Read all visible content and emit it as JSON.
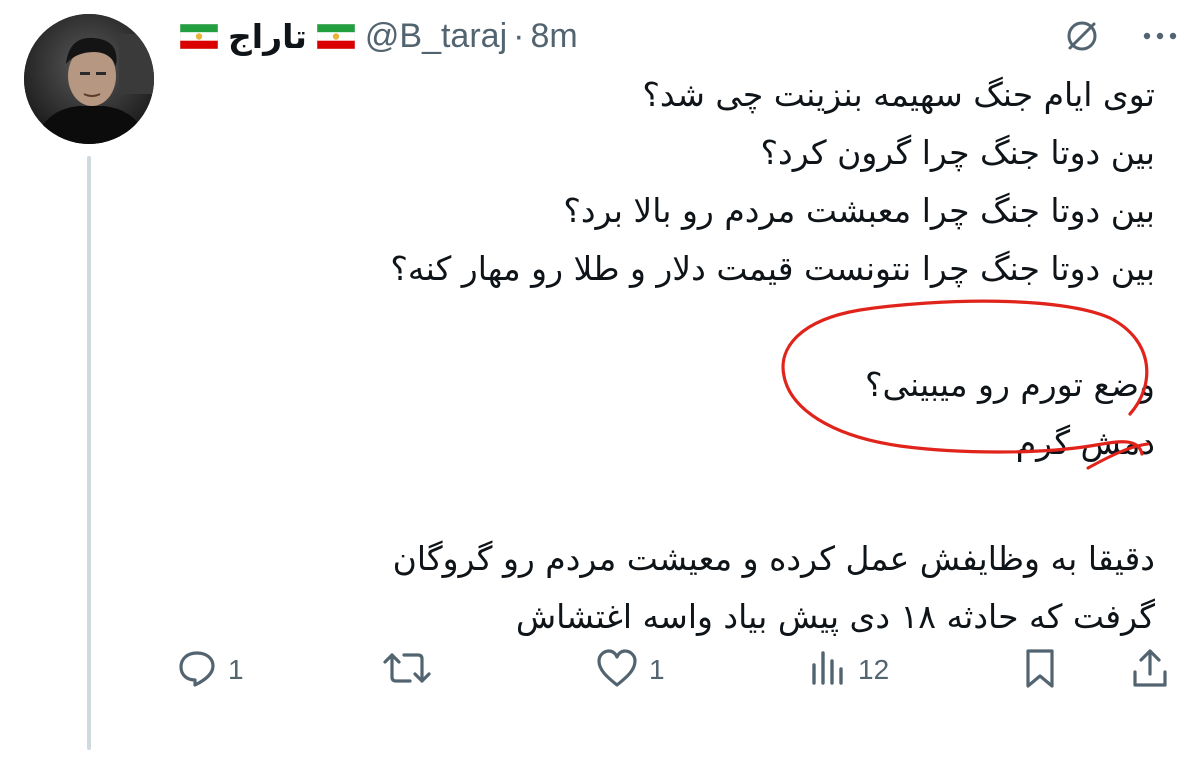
{
  "author": {
    "display_name": "تاراج",
    "handle": "@B_taraj",
    "separator": "·",
    "time": "8m"
  },
  "icons": {
    "flag": "iran-flag-icon",
    "grok": "grok-icon",
    "more": "more-icon",
    "reply": "reply-icon",
    "retweet": "retweet-icon",
    "like": "like-icon",
    "views": "views-icon",
    "bookmark": "bookmark-icon",
    "share": "share-icon"
  },
  "tweet": {
    "lines": [
      "توی ایام جنگ سهیمه بنزینت چی شد؟",
      "بین دوتا جنگ چرا گرون کرد؟",
      "بین دوتا جنگ چرا معبشت مردم رو بالا برد؟",
      "بین دوتا جنگ چرا نتونست قیمت دلار و طلا رو مهار کنه؟",
      "",
      "وضع تورم رو میبینی؟",
      "دمش گرم",
      "",
      "دقیقا به وظایفش عمل کرده و معیشت مردم رو گروگان",
      "گرفت که حادثه ۱۸ دی پیش بیاد واسه اغتشاش"
    ]
  },
  "actions": {
    "reply_count": "1",
    "retweet_count": "",
    "like_count": "1",
    "view_count": "12"
  },
  "colors": {
    "text": "#0f1419",
    "muted": "#536471",
    "thread_line": "#cfd9de",
    "annotation_red": "#e0241b"
  }
}
